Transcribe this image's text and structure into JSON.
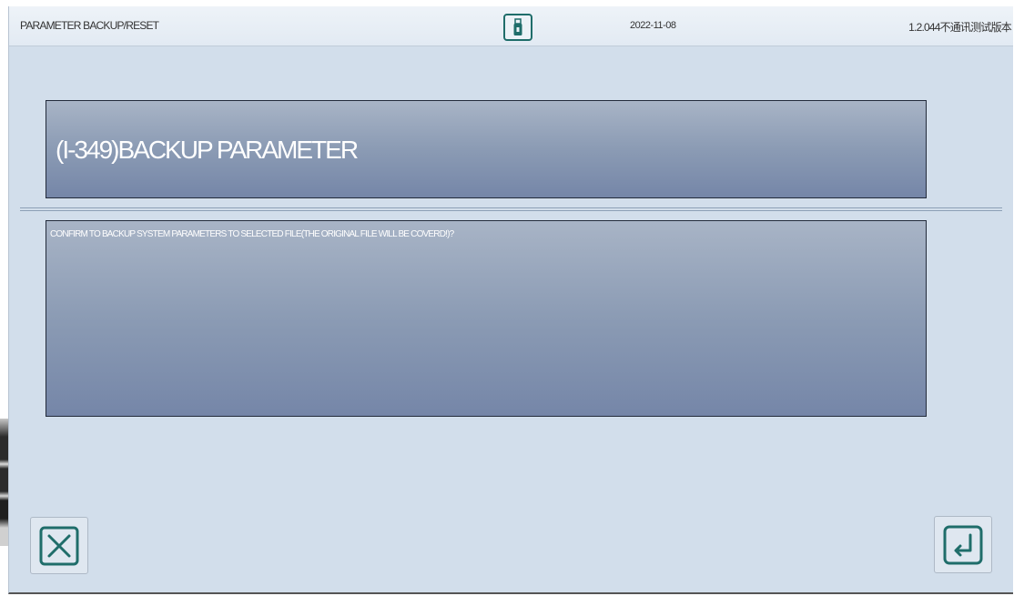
{
  "header": {
    "title": "PARAMETER BACKUP/RESET",
    "date": "2022-11-08",
    "version": "1.2.044不通讯测试版本",
    "usb_icon": "usb-drive-icon"
  },
  "dialog": {
    "heading": "(I-349)BACKUP PARAMETER",
    "message": "CONFIRM TO BACKUP SYSTEM PARAMETERS TO SELECTED FILE(THE ORIGINAL FILE WILL BE COVERD!)?"
  },
  "buttons": {
    "cancel_icon": "close-icon",
    "confirm_icon": "enter-icon"
  },
  "colors": {
    "background": "#d2deeb",
    "panel_top": "#a8b4c6",
    "panel_bottom": "#7586a8",
    "icon_accent": "#1f6d6a"
  }
}
